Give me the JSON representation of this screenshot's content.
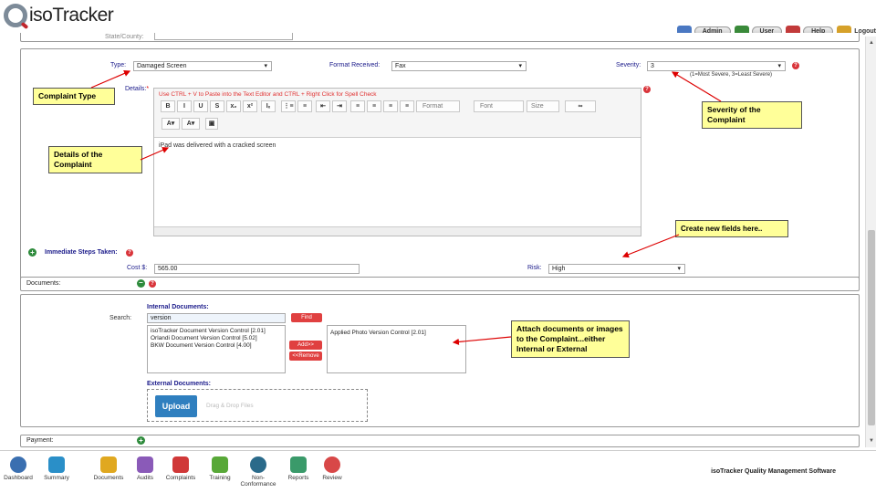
{
  "app": {
    "title": "isoTracker"
  },
  "topbar": [
    {
      "label": "Admin",
      "color": "#4a78c2"
    },
    {
      "label": "User",
      "color": "#3a8a3a"
    },
    {
      "label": "Help",
      "color": "#c23a3a"
    },
    {
      "label": "Logout",
      "color": "#d6a12a"
    }
  ],
  "form": {
    "state_county_label": "State/County:",
    "type_label": "Type:",
    "type_value": "Damaged Screen",
    "format_label": "Format Received:",
    "format_value": "Fax",
    "severity_label": "Severity:",
    "severity_value": "3",
    "severity_hint": "(1=Most Severe, 3=Least Severe)",
    "details_label": "Details:",
    "details_required": "*",
    "editor_hint": "Use CTRL + V to Paste into the Text Editor and CTRL + Right Click for Spell Check",
    "editor_text": "iPad was delivered with a cracked screen",
    "editor_format": "Format",
    "editor_font": "Font",
    "editor_size": "Size",
    "immediate_label": "Immediate Steps Taken:",
    "cost_label": "Cost $:",
    "cost_value": "565.00",
    "risk_label": "Risk:",
    "risk_value": "High"
  },
  "toolbar_buttons": [
    "B",
    "I",
    "U",
    "S",
    "x₂",
    "x²",
    "Iₓ",
    "⋮≡",
    "≡",
    "⇤",
    "⇥",
    "≡",
    "≡",
    "≡",
    "≡"
  ],
  "documents": {
    "section_label": "Documents:",
    "internal_title": "Internal Documents:",
    "search_label": "Search:",
    "search_value": "version",
    "find_label": "Find",
    "add_label": "Add>>",
    "remove_label": "<<Remove",
    "available": [
      "isoTracker Document Version Control [2.01]",
      "Orlandi Document Version Control [5.02]",
      "BKW Document Version Control [4.00]"
    ],
    "selected": [
      "Applied Photo Version Control [2.01]"
    ],
    "external_title": "External Documents:",
    "upload_label": "Upload",
    "drop_label": "Drag & Drop Files"
  },
  "payment": {
    "label": "Payment:"
  },
  "callouts": {
    "complaint_type": "Complaint Type",
    "details": "Details of the Complaint",
    "severity": "Severity of the Complaint",
    "new_fields": "Create new fields here..",
    "attach": "Attach documents or images to the Complaint...either Internal or External"
  },
  "nav": [
    {
      "label": "Dashboard",
      "icon": "dashboard-icon",
      "color": "#3a6fb0"
    },
    {
      "label": "Summary",
      "icon": "summary-icon",
      "color": "#2a8fc8"
    },
    {
      "label": "Documents",
      "icon": "documents-icon",
      "color": "#e0a820"
    },
    {
      "label": "Audits",
      "icon": "audits-icon",
      "color": "#8a5ab8"
    },
    {
      "label": "Complaints",
      "icon": "complaints-icon",
      "color": "#d03838"
    },
    {
      "label": "Training",
      "icon": "training-icon",
      "color": "#58a838"
    },
    {
      "label": "Non-Conformance",
      "icon": "non-conformance-icon",
      "color": "#2a6a8a"
    },
    {
      "label": "Reports",
      "icon": "reports-icon",
      "color": "#3a9a6a"
    },
    {
      "label": "Review",
      "icon": "review-icon",
      "color": "#d84848"
    }
  ],
  "brand": "isoTracker Quality Management Software"
}
